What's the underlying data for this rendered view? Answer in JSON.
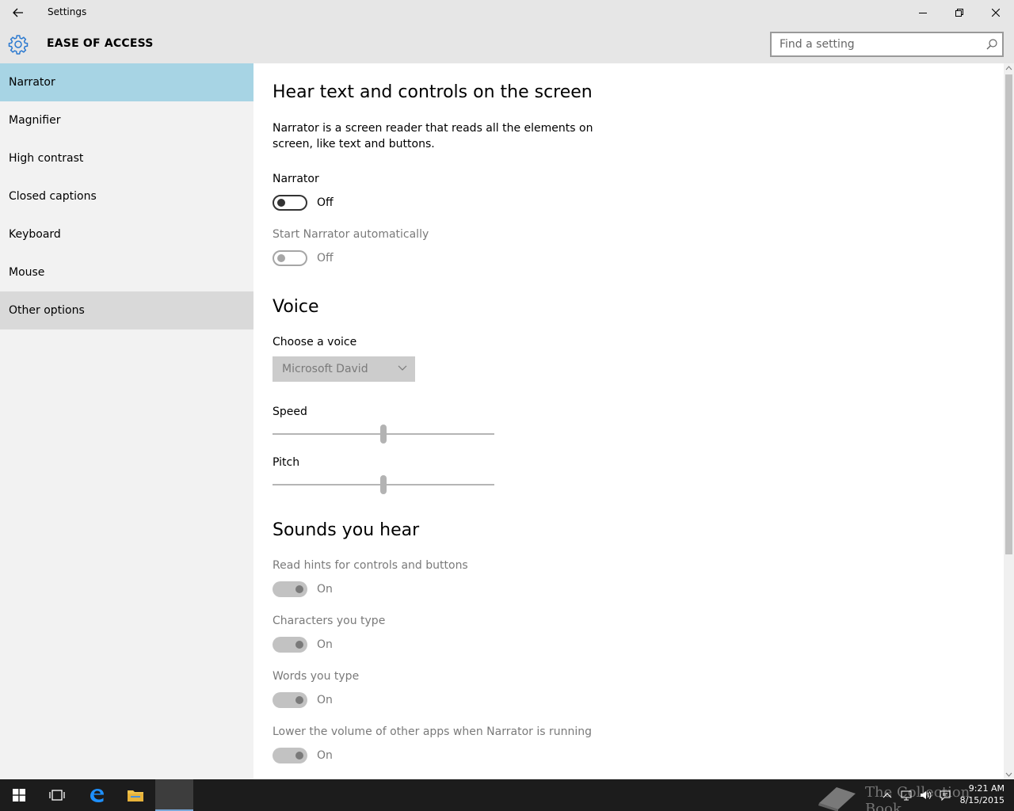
{
  "window": {
    "title": "Settings"
  },
  "header": {
    "title": "EASE OF ACCESS",
    "search_placeholder": "Find a setting"
  },
  "sidebar": {
    "items": [
      {
        "label": "Narrator",
        "state": "selected"
      },
      {
        "label": "Magnifier",
        "state": "normal"
      },
      {
        "label": "High contrast",
        "state": "normal"
      },
      {
        "label": "Closed captions",
        "state": "normal"
      },
      {
        "label": "Keyboard",
        "state": "normal"
      },
      {
        "label": "Mouse",
        "state": "normal"
      },
      {
        "label": "Other options",
        "state": "hover"
      }
    ]
  },
  "content": {
    "main_heading": "Hear text and controls on the screen",
    "description": "Narrator is a screen reader that reads all the elements on screen, like text and buttons.",
    "narrator": {
      "label": "Narrator",
      "state": "Off"
    },
    "start_auto": {
      "label": "Start Narrator automatically",
      "state": "Off"
    },
    "voice": {
      "heading": "Voice",
      "choose_label": "Choose a voice",
      "selected_voice": "Microsoft David",
      "speed_label": "Speed",
      "speed_value": 0.5,
      "pitch_label": "Pitch",
      "pitch_value": 0.5
    },
    "sounds": {
      "heading": "Sounds you hear",
      "items": [
        {
          "label": "Read hints for controls and buttons",
          "state": "On"
        },
        {
          "label": "Characters you type",
          "state": "On"
        },
        {
          "label": "Words you type",
          "state": "On"
        },
        {
          "label": "Lower the volume of other apps when Narrator is running",
          "state": "On"
        }
      ]
    }
  },
  "taskbar": {
    "time": "9:21 AM",
    "date": "8/15/2015",
    "watermark": "The Collection Book"
  },
  "colors": {
    "selected_nav": "#a7d4e4",
    "hover_nav": "#d9d9d9",
    "accent": "#2b79d0"
  }
}
